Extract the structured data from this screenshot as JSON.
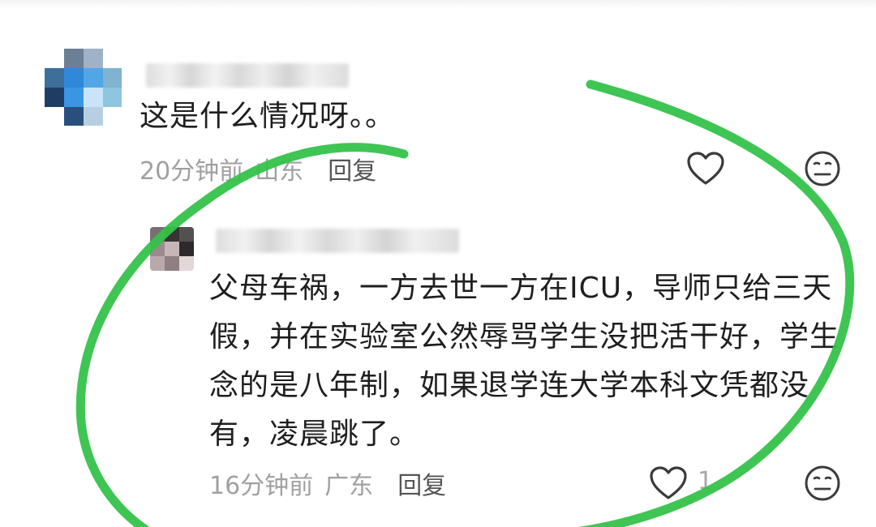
{
  "comments": [
    {
      "text": "这是什么情况呀。。",
      "time": "20分钟前",
      "location": "山东",
      "reply_label": "回复"
    },
    {
      "text": "父母车祸，一方去世一方在ICU，导师只给三天假，并在实验室公然辱骂学生没把活干好，学生念的是八年制，如果退学连大学本科文凭都没有，凌晨跳了。",
      "time": "16分钟前",
      "location": "广东",
      "reply_label": "回复",
      "like_count": "1"
    }
  ],
  "icons": {
    "like": "heart-icon",
    "dislike": "neutral-face-icon"
  },
  "colors": {
    "annotation": "#35c24a",
    "meta_text": "#a0a0a0",
    "body_text": "#1e1e1e"
  }
}
